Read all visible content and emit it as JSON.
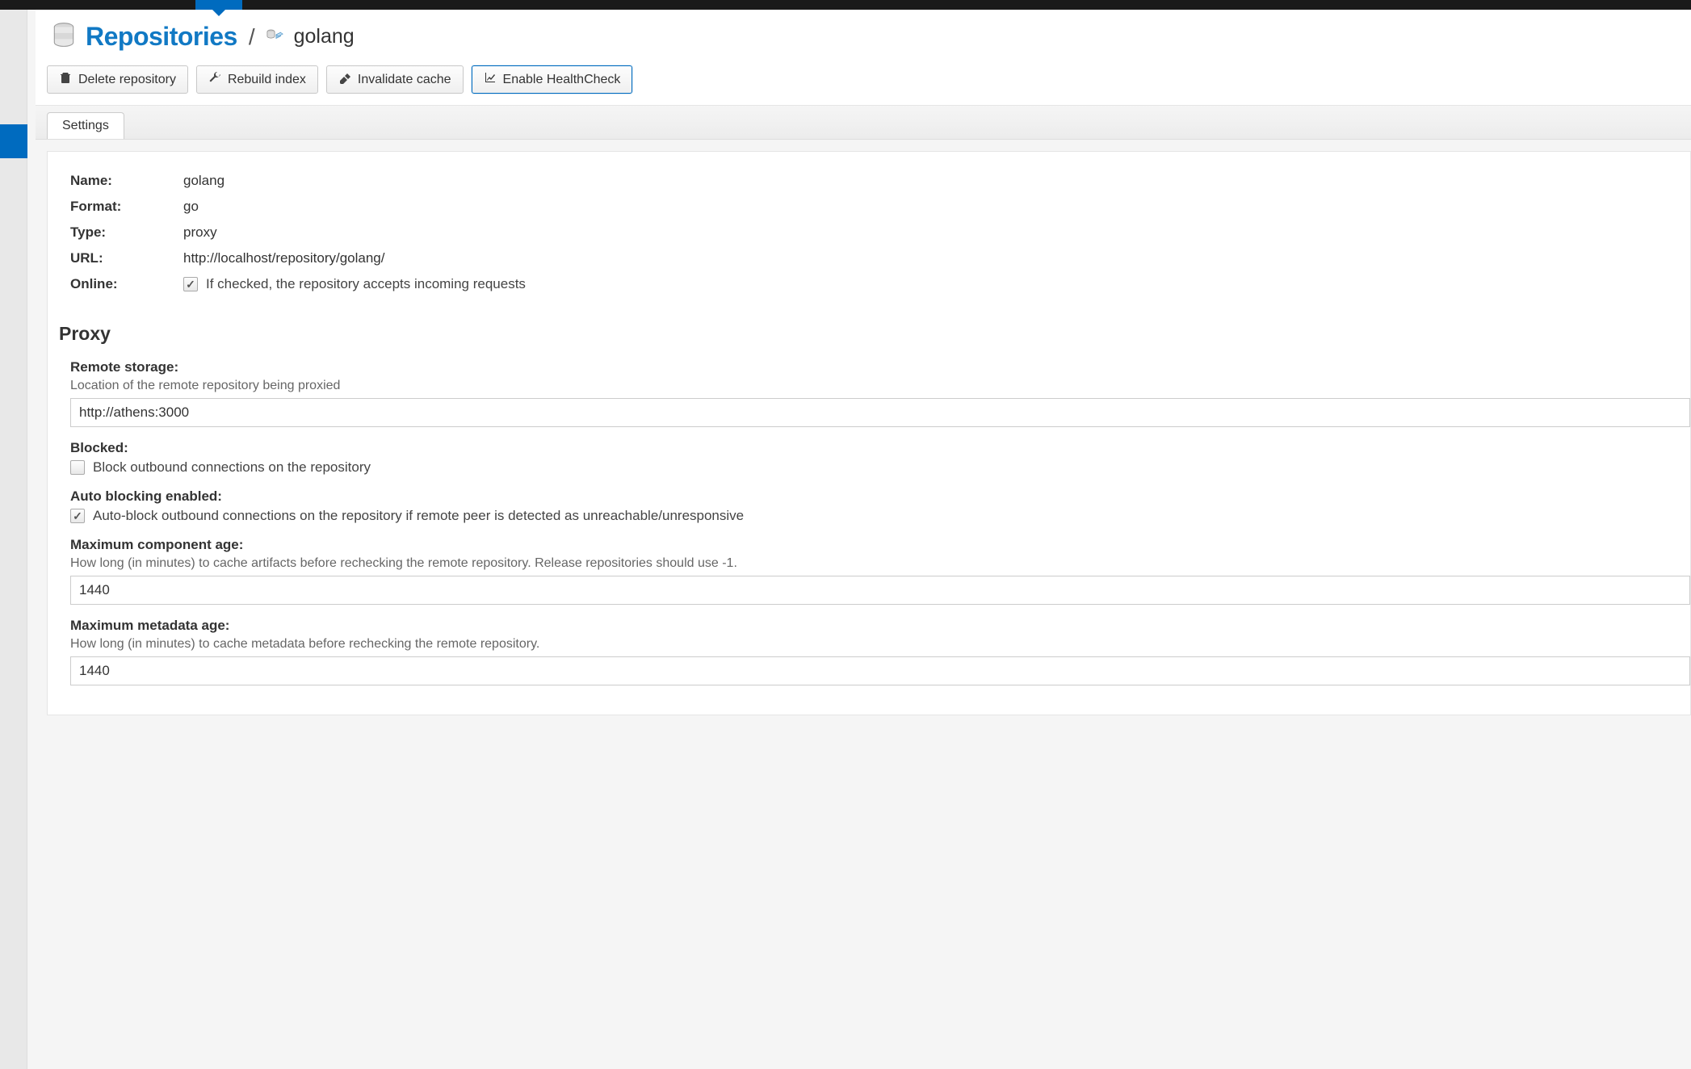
{
  "header": {
    "title": "Repositories",
    "separator": "/",
    "repo_name": "golang"
  },
  "toolbar": {
    "delete_label": "Delete repository",
    "rebuild_label": "Rebuild index",
    "invalidate_label": "Invalidate cache",
    "healthcheck_label": "Enable HealthCheck"
  },
  "tabs": {
    "settings_label": "Settings"
  },
  "summary": {
    "name_label": "Name:",
    "name_value": "golang",
    "format_label": "Format:",
    "format_value": "go",
    "type_label": "Type:",
    "type_value": "proxy",
    "url_label": "URL:",
    "url_value": "http://localhost/repository/golang/",
    "online_label": "Online:",
    "online_help": "If checked, the repository accepts incoming requests"
  },
  "proxy": {
    "section_title": "Proxy",
    "remote_storage_label": "Remote storage:",
    "remote_storage_help": "Location of the remote repository being proxied",
    "remote_storage_value": "http://athens:3000",
    "blocked_label": "Blocked:",
    "blocked_help": "Block outbound connections on the repository",
    "auto_blocking_label": "Auto blocking enabled:",
    "auto_blocking_help": "Auto-block outbound connections on the repository if remote peer is detected as unreachable/unresponsive",
    "max_component_age_label": "Maximum component age:",
    "max_component_age_help": "How long (in minutes) to cache artifacts before rechecking the remote repository. Release repositories should use -1.",
    "max_component_age_value": "1440",
    "max_metadata_age_label": "Maximum metadata age:",
    "max_metadata_age_help": "How long (in minutes) to cache metadata before rechecking the remote repository.",
    "max_metadata_age_value": "1440"
  }
}
